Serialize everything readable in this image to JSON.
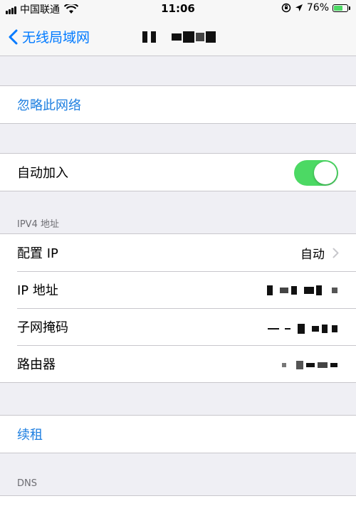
{
  "status_bar": {
    "carrier": "中国联通",
    "time": "11:06",
    "battery": "76%",
    "battery_level": 0.76,
    "icons": [
      "signal-icon",
      "wifi-icon",
      "orientation-lock-icon",
      "location-icon",
      "battery-icon"
    ]
  },
  "nav": {
    "back_label": "无线局域网",
    "title_redacted": true
  },
  "actions": {
    "forget_network": "忽略此网络",
    "renew_lease": "续租"
  },
  "auto_join": {
    "label": "自动加入",
    "enabled": true
  },
  "ipv4": {
    "header": "IPV4 地址",
    "configure_ip_label": "配置 IP",
    "configure_ip_value": "自动",
    "ip_address_label": "IP 地址",
    "subnet_mask_label": "子网掩码",
    "router_label": "路由器"
  },
  "dns": {
    "header": "DNS"
  },
  "colors": {
    "accent": "#007aff",
    "action_text": "#1c7ee0",
    "toggle_on": "#4cd964",
    "background": "#efeff4"
  }
}
